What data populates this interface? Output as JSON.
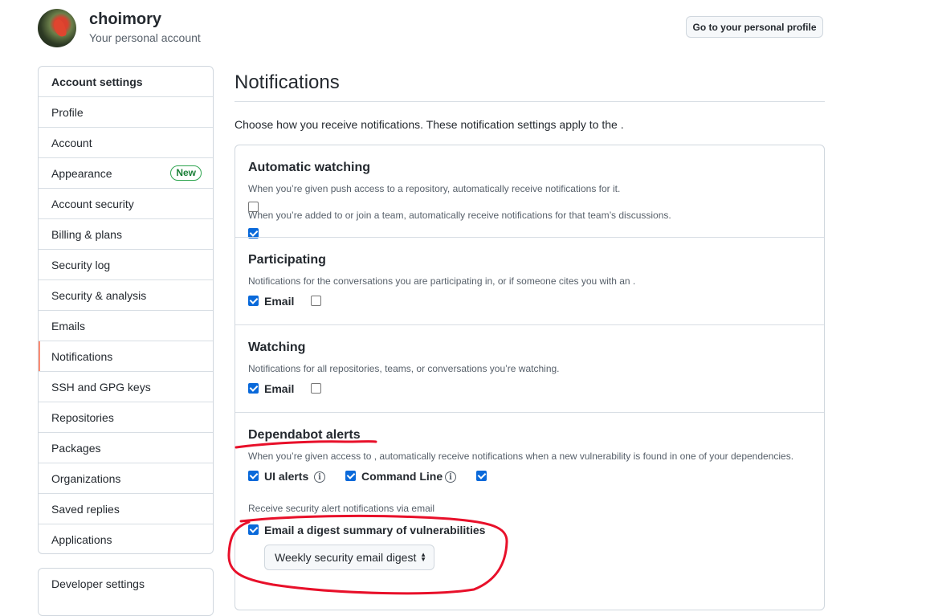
{
  "header": {
    "username": "choimory",
    "subtitle": "Your personal account",
    "profile_button": "Go to your personal profile"
  },
  "sidebar": {
    "heading": "Account settings",
    "items": [
      {
        "label": "Profile"
      },
      {
        "label": "Account"
      },
      {
        "label": "Appearance",
        "badge": "New"
      },
      {
        "label": "Account security"
      },
      {
        "label": "Billing & plans"
      },
      {
        "label": "Security log"
      },
      {
        "label": "Security & analysis"
      },
      {
        "label": "Emails"
      },
      {
        "label": "Notifications",
        "selected": true
      },
      {
        "label": "SSH and GPG keys"
      },
      {
        "label": "Repositories"
      },
      {
        "label": "Packages"
      },
      {
        "label": "Organizations"
      },
      {
        "label": "Saved replies"
      },
      {
        "label": "Applications"
      }
    ],
    "developer_settings": "Developer settings"
  },
  "main": {
    "title": "Notifications",
    "intro": "Choose how you receive notifications. These notification settings apply to the .",
    "automatic_watching": {
      "title": "Automatic watching",
      "desc1": "When you’re given push access to a repository, automatically receive notifications for it.",
      "checkbox1_checked": false,
      "desc2": "When you’re added to or join a team, automatically receive notifications for that team’s discussions.",
      "checkbox2_checked": true
    },
    "participating": {
      "title": "Participating",
      "desc": "Notifications for the conversations you are participating in, or if someone cites you with an .",
      "email_label": "Email",
      "email_checked": true,
      "web_checked": false
    },
    "watching": {
      "title": "Watching",
      "desc": "Notifications for all repositories, teams, or conversations you’re watching.",
      "email_label": "Email",
      "email_checked": true,
      "web_checked": false
    },
    "dependabot": {
      "title": "Dependabot alerts",
      "desc": "When you’re given access to , automatically receive notifications when a new vulnerability is found in one of your dependencies.",
      "ui_alerts_label": "UI alerts",
      "ui_alerts_checked": true,
      "command_line_label": "Command Line",
      "command_line_checked": true,
      "third_checked": true,
      "email_heading": "Receive security alert notifications via email",
      "digest_label": "Email a digest summary of vulnerabilities",
      "digest_checked": true,
      "digest_select": "Weekly security email digest"
    }
  },
  "colors": {
    "accent_blue": "#0969da",
    "selected_marker": "#fd8c73",
    "badge_green": "#1a7f37",
    "annotation_red": "#e8102a"
  },
  "icons": [
    "info-icon",
    "select-caret-icon"
  ]
}
